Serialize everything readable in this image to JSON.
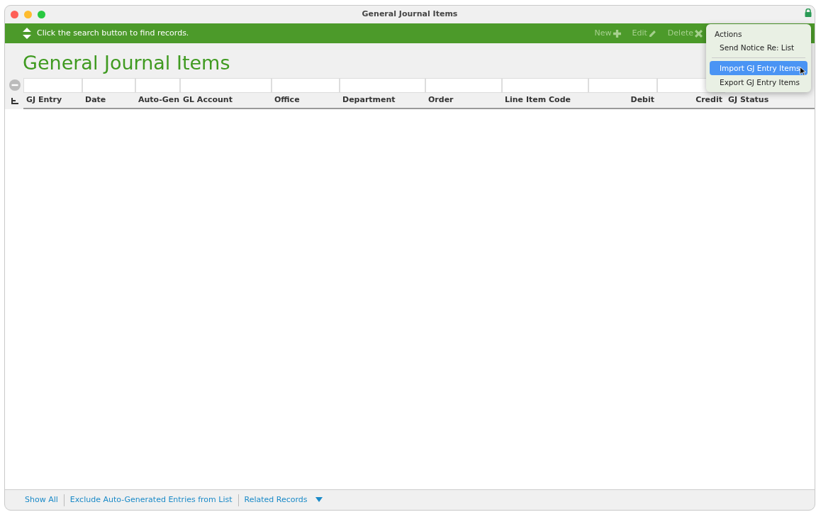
{
  "window": {
    "title": "General Journal Items"
  },
  "status_bar": {
    "message": "Click the search button to find records."
  },
  "toolbar": [
    {
      "label": "New",
      "kind": "new",
      "disabled": true
    },
    {
      "label": "Edit",
      "kind": "edit",
      "disabled": true
    },
    {
      "label": "Delete",
      "kind": "delete",
      "disabled": true
    }
  ],
  "page_title": "General Journal Items",
  "table": {
    "columns": [
      {
        "name": "GJ Entry"
      },
      {
        "name": "Date"
      },
      {
        "name": "Auto-Gen"
      },
      {
        "name": "GL Account"
      },
      {
        "name": "Office"
      },
      {
        "name": "Department"
      },
      {
        "name": "Order"
      },
      {
        "name": "Line Item Code"
      },
      {
        "name": "Debit"
      },
      {
        "name": "Credit"
      },
      {
        "name": "GJ Status"
      }
    ]
  },
  "actions_menu": {
    "heading": "Actions",
    "items": [
      {
        "kind": "item",
        "label": "Send Notice Re: List",
        "selected": false
      },
      {
        "kind": "separator"
      },
      {
        "kind": "item",
        "label": "Import GJ Entry Items",
        "selected": true
      },
      {
        "kind": "item",
        "label": "Export GJ Entry Items",
        "selected": false
      }
    ]
  },
  "footer": [
    {
      "label": "Show All",
      "dropdown": false
    },
    {
      "label": "Exclude Auto-Generated Entries from List",
      "dropdown": false
    },
    {
      "label": "Related Records",
      "dropdown": true
    }
  ]
}
